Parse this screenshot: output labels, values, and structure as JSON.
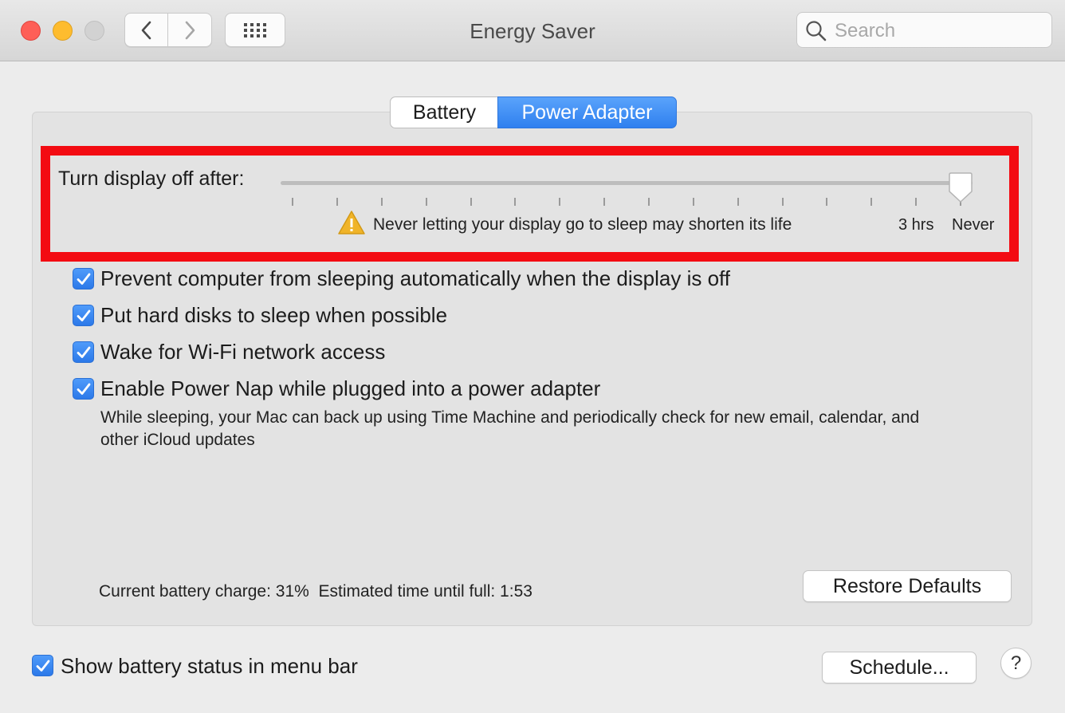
{
  "window": {
    "title": "Energy Saver"
  },
  "toolbar": {
    "back_icon": "chevron-left-icon",
    "forward_icon": "chevron-right-icon",
    "grid_icon": "grid-icon",
    "search_placeholder": "Search"
  },
  "tabs": [
    {
      "label": "Battery",
      "selected": false
    },
    {
      "label": "Power Adapter",
      "selected": true
    }
  ],
  "display_sleep": {
    "label": "Turn display off after:",
    "value": "Never",
    "warning": "Never letting your display go to sleep may shorten its life",
    "tick_labels": [
      "3 hrs",
      "Never"
    ]
  },
  "options": [
    {
      "label": "Prevent computer from sleeping automatically when the display is off",
      "checked": true
    },
    {
      "label": "Put hard disks to sleep when possible",
      "checked": true
    },
    {
      "label": "Wake for Wi-Fi network access",
      "checked": true
    },
    {
      "label": "Enable Power Nap while plugged into a power adapter",
      "checked": true,
      "description": "While sleeping, your Mac can back up using Time Machine and periodically check for new email, calendar, and other iCloud updates"
    }
  ],
  "status_text": "Current battery charge: 31%  Estimated time until full: 1:53",
  "buttons": {
    "restore_defaults": "Restore Defaults",
    "schedule": "Schedule...",
    "help": "?"
  },
  "show_battery_status": {
    "label": "Show battery status in menu bar",
    "checked": true
  },
  "colors": {
    "accent": "#2f80ef",
    "highlight_box": "#f30b12",
    "warning": "#f0b429"
  }
}
